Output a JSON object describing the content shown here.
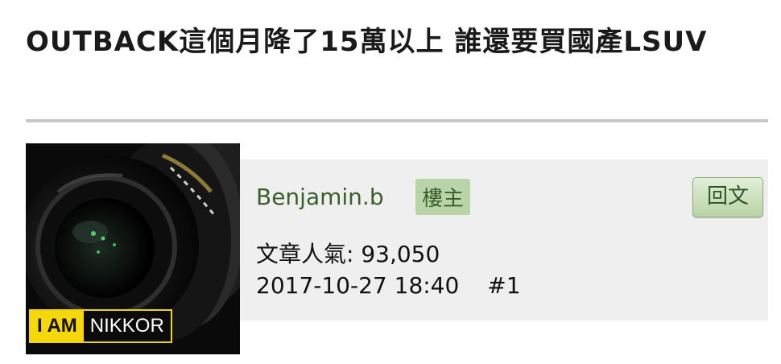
{
  "thread": {
    "title": "OUTBACK這個月降了15萬以上 誰還要買國產LSUV"
  },
  "post": {
    "avatar": {
      "badge_part1": "I AM",
      "badge_part2": "NIKKOR"
    },
    "author": {
      "name": "Benjamin.b",
      "tag": "樓主"
    },
    "reply_label": "回文",
    "popularity": "文章人氣: 93,050",
    "date": "2017-10-27 18:40",
    "floor": "#1"
  }
}
